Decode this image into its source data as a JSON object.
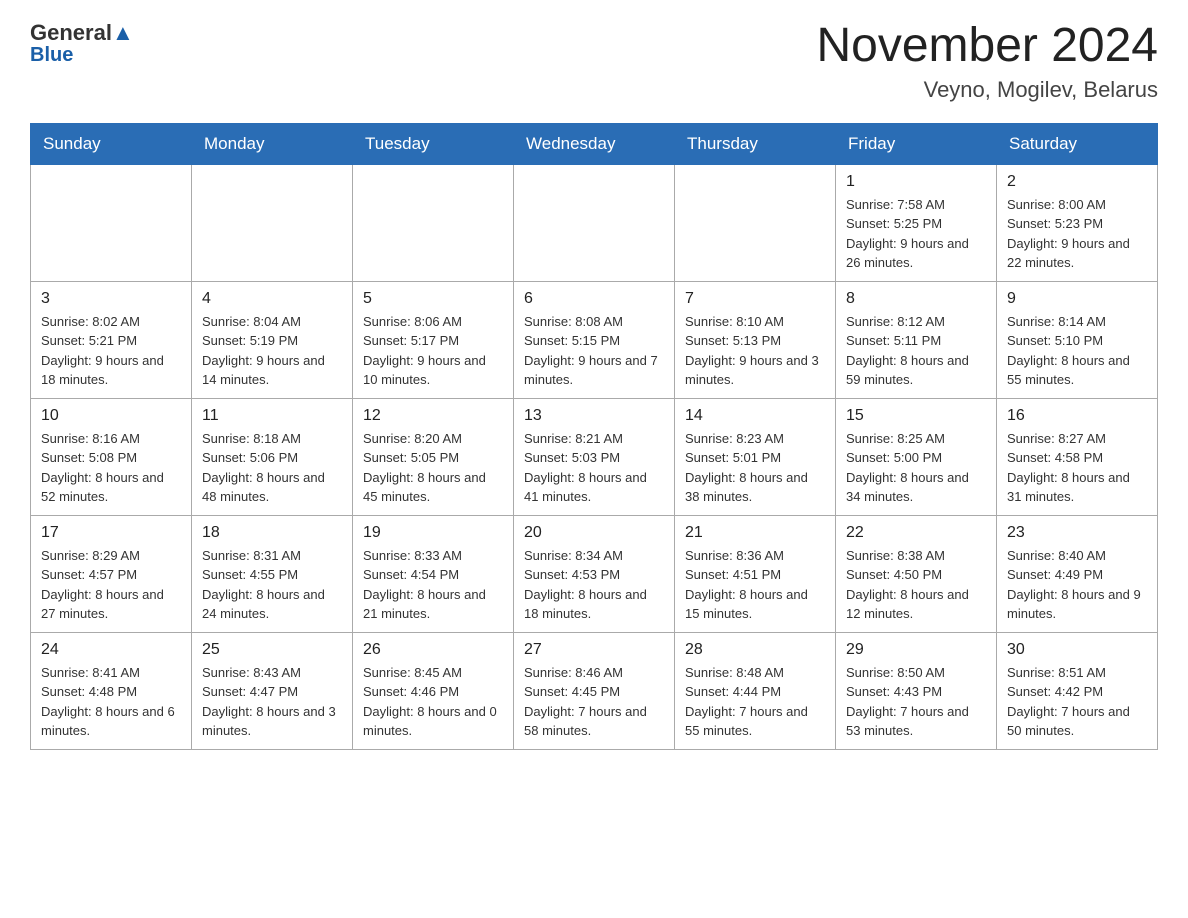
{
  "header": {
    "logo_general": "General",
    "logo_blue": "Blue",
    "month_year": "November 2024",
    "location": "Veyno, Mogilev, Belarus"
  },
  "days_of_week": [
    "Sunday",
    "Monday",
    "Tuesday",
    "Wednesday",
    "Thursday",
    "Friday",
    "Saturday"
  ],
  "weeks": [
    [
      {
        "day": "",
        "info": ""
      },
      {
        "day": "",
        "info": ""
      },
      {
        "day": "",
        "info": ""
      },
      {
        "day": "",
        "info": ""
      },
      {
        "day": "",
        "info": ""
      },
      {
        "day": "1",
        "info": "Sunrise: 7:58 AM\nSunset: 5:25 PM\nDaylight: 9 hours and 26 minutes."
      },
      {
        "day": "2",
        "info": "Sunrise: 8:00 AM\nSunset: 5:23 PM\nDaylight: 9 hours and 22 minutes."
      }
    ],
    [
      {
        "day": "3",
        "info": "Sunrise: 8:02 AM\nSunset: 5:21 PM\nDaylight: 9 hours and 18 minutes."
      },
      {
        "day": "4",
        "info": "Sunrise: 8:04 AM\nSunset: 5:19 PM\nDaylight: 9 hours and 14 minutes."
      },
      {
        "day": "5",
        "info": "Sunrise: 8:06 AM\nSunset: 5:17 PM\nDaylight: 9 hours and 10 minutes."
      },
      {
        "day": "6",
        "info": "Sunrise: 8:08 AM\nSunset: 5:15 PM\nDaylight: 9 hours and 7 minutes."
      },
      {
        "day": "7",
        "info": "Sunrise: 8:10 AM\nSunset: 5:13 PM\nDaylight: 9 hours and 3 minutes."
      },
      {
        "day": "8",
        "info": "Sunrise: 8:12 AM\nSunset: 5:11 PM\nDaylight: 8 hours and 59 minutes."
      },
      {
        "day": "9",
        "info": "Sunrise: 8:14 AM\nSunset: 5:10 PM\nDaylight: 8 hours and 55 minutes."
      }
    ],
    [
      {
        "day": "10",
        "info": "Sunrise: 8:16 AM\nSunset: 5:08 PM\nDaylight: 8 hours and 52 minutes."
      },
      {
        "day": "11",
        "info": "Sunrise: 8:18 AM\nSunset: 5:06 PM\nDaylight: 8 hours and 48 minutes."
      },
      {
        "day": "12",
        "info": "Sunrise: 8:20 AM\nSunset: 5:05 PM\nDaylight: 8 hours and 45 minutes."
      },
      {
        "day": "13",
        "info": "Sunrise: 8:21 AM\nSunset: 5:03 PM\nDaylight: 8 hours and 41 minutes."
      },
      {
        "day": "14",
        "info": "Sunrise: 8:23 AM\nSunset: 5:01 PM\nDaylight: 8 hours and 38 minutes."
      },
      {
        "day": "15",
        "info": "Sunrise: 8:25 AM\nSunset: 5:00 PM\nDaylight: 8 hours and 34 minutes."
      },
      {
        "day": "16",
        "info": "Sunrise: 8:27 AM\nSunset: 4:58 PM\nDaylight: 8 hours and 31 minutes."
      }
    ],
    [
      {
        "day": "17",
        "info": "Sunrise: 8:29 AM\nSunset: 4:57 PM\nDaylight: 8 hours and 27 minutes."
      },
      {
        "day": "18",
        "info": "Sunrise: 8:31 AM\nSunset: 4:55 PM\nDaylight: 8 hours and 24 minutes."
      },
      {
        "day": "19",
        "info": "Sunrise: 8:33 AM\nSunset: 4:54 PM\nDaylight: 8 hours and 21 minutes."
      },
      {
        "day": "20",
        "info": "Sunrise: 8:34 AM\nSunset: 4:53 PM\nDaylight: 8 hours and 18 minutes."
      },
      {
        "day": "21",
        "info": "Sunrise: 8:36 AM\nSunset: 4:51 PM\nDaylight: 8 hours and 15 minutes."
      },
      {
        "day": "22",
        "info": "Sunrise: 8:38 AM\nSunset: 4:50 PM\nDaylight: 8 hours and 12 minutes."
      },
      {
        "day": "23",
        "info": "Sunrise: 8:40 AM\nSunset: 4:49 PM\nDaylight: 8 hours and 9 minutes."
      }
    ],
    [
      {
        "day": "24",
        "info": "Sunrise: 8:41 AM\nSunset: 4:48 PM\nDaylight: 8 hours and 6 minutes."
      },
      {
        "day": "25",
        "info": "Sunrise: 8:43 AM\nSunset: 4:47 PM\nDaylight: 8 hours and 3 minutes."
      },
      {
        "day": "26",
        "info": "Sunrise: 8:45 AM\nSunset: 4:46 PM\nDaylight: 8 hours and 0 minutes."
      },
      {
        "day": "27",
        "info": "Sunrise: 8:46 AM\nSunset: 4:45 PM\nDaylight: 7 hours and 58 minutes."
      },
      {
        "day": "28",
        "info": "Sunrise: 8:48 AM\nSunset: 4:44 PM\nDaylight: 7 hours and 55 minutes."
      },
      {
        "day": "29",
        "info": "Sunrise: 8:50 AM\nSunset: 4:43 PM\nDaylight: 7 hours and 53 minutes."
      },
      {
        "day": "30",
        "info": "Sunrise: 8:51 AM\nSunset: 4:42 PM\nDaylight: 7 hours and 50 minutes."
      }
    ]
  ]
}
